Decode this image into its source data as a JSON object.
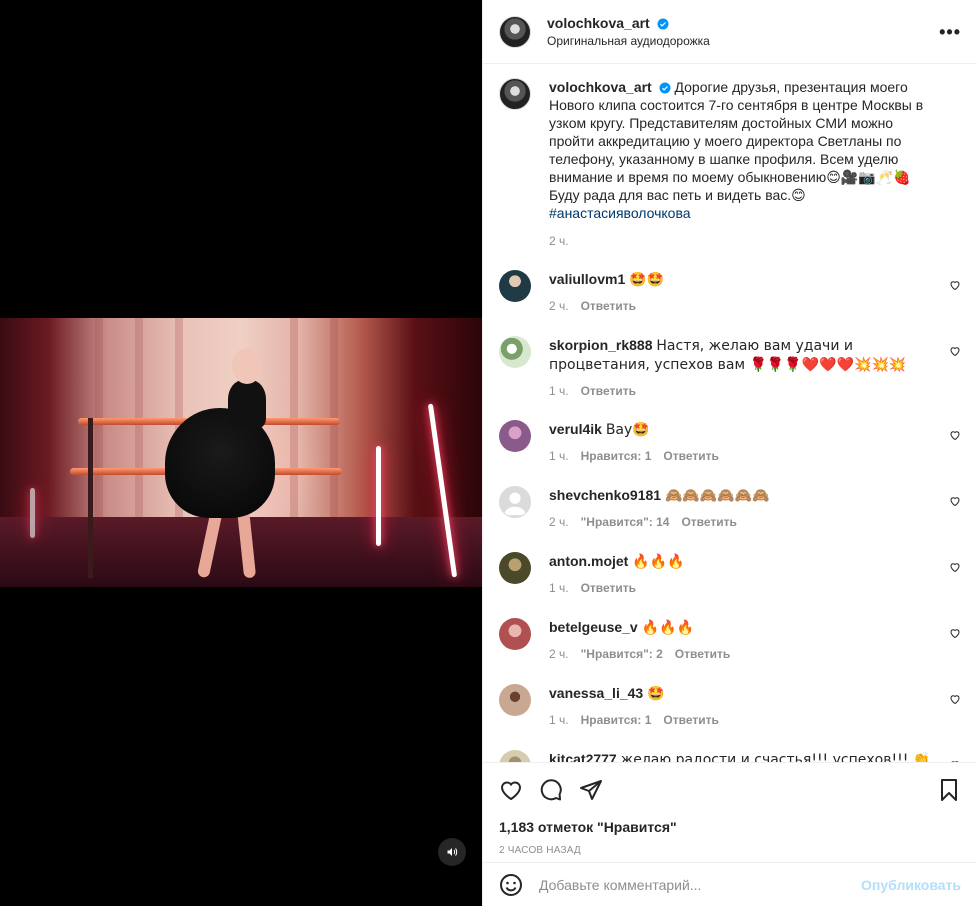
{
  "post": {
    "author": "volochkova_art",
    "audio": "Оригинальная аудиодорожка",
    "more_label": "•••"
  },
  "caption": {
    "author": "volochkova_art",
    "text": "Дорогие друзья, презентация моего Нового клипа состоится 7-го сентября в центре Москвы в узком кругу. Представителям достойных СМИ можно пройти аккредитацию у моего директора Светланы по телефону, указанному в шапке профиля. Всем уделю внимание и время по моему обыкновению😊🎥📷🥂🍓 Буду рада для вас петь и видеть вас.😊",
    "hashtag": "#анастасияволочкова",
    "time": "2 ч."
  },
  "comments": [
    {
      "user": "valiullovm1",
      "text": "🤩🤩",
      "time": "2 ч.",
      "likes": "",
      "reply": "Ответить"
    },
    {
      "user": "skorpion_rk888",
      "text": "Настя, желаю вам удачи и процветания, успехов вам 🌹🌹🌹❤️❤️❤️💥💥💥",
      "time": "1 ч.",
      "likes": "",
      "reply": "Ответить"
    },
    {
      "user": "verul4ik",
      "text": "Вау🤩",
      "time": "1 ч.",
      "likes": "Нравится: 1",
      "reply": "Ответить"
    },
    {
      "user": "shevchenko9181",
      "text": "🙈🙈🙈🙈🙈🙈",
      "time": "2 ч.",
      "likes": "\"Нравится\": 14",
      "reply": "Ответить"
    },
    {
      "user": "anton.mojet",
      "text": "🔥🔥🔥",
      "time": "1 ч.",
      "likes": "",
      "reply": "Ответить"
    },
    {
      "user": "betelgeuse_v",
      "text": "🔥🔥🔥",
      "time": "2 ч.",
      "likes": "\"Нравится\": 2",
      "reply": "Ответить"
    },
    {
      "user": "vanessa_li_43",
      "text": "🤩",
      "time": "1 ч.",
      "likes": "Нравится: 1",
      "reply": "Ответить"
    },
    {
      "user": "kitcat2777",
      "text": "желаю радости и счастья!!! успехов!!! 👏👏👏🌹🌹🌹🌹",
      "time": "",
      "likes": "",
      "reply": ""
    }
  ],
  "stats": {
    "likes": "1,183 отметок \"Нравится\"",
    "time": "2 ЧАСОВ НАЗАД"
  },
  "add_comment": {
    "placeholder": "Добавьте комментарий...",
    "publish": "Опубликовать"
  },
  "colors": {
    "verified": "#0095f6",
    "publish_disabled": "#b2dffc",
    "meta": "#8e8e8e",
    "hashtag": "#00376b"
  }
}
